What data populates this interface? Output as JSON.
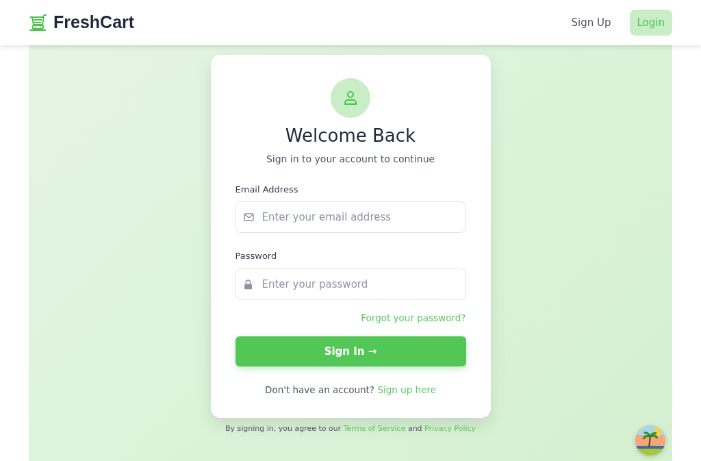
{
  "navbar": {
    "brand": "FreshCart",
    "links": [
      {
        "label": "Sign Up",
        "selected": false
      },
      {
        "label": "Login",
        "selected": true
      }
    ]
  },
  "login_card": {
    "title": "Welcome Back",
    "subtitle": "Sign in to your account to continue",
    "fields": [
      {
        "kind": "email",
        "label": "Email Address",
        "placeholder": "Enter your email address"
      },
      {
        "kind": "password",
        "label": "Password",
        "placeholder": "Enter your password"
      }
    ],
    "forgot_link": "Forgot your password?",
    "submit_button": "Sign In",
    "submit_arrow": "→",
    "signup_prompt": "Don't have an account?",
    "signup_link": "Sign up here"
  },
  "footer_note": {
    "text": "By signing in, you agree to our ",
    "terms_link": "Terms of Service",
    "and": " and ",
    "privacy_link": "Privacy Policy"
  }
}
